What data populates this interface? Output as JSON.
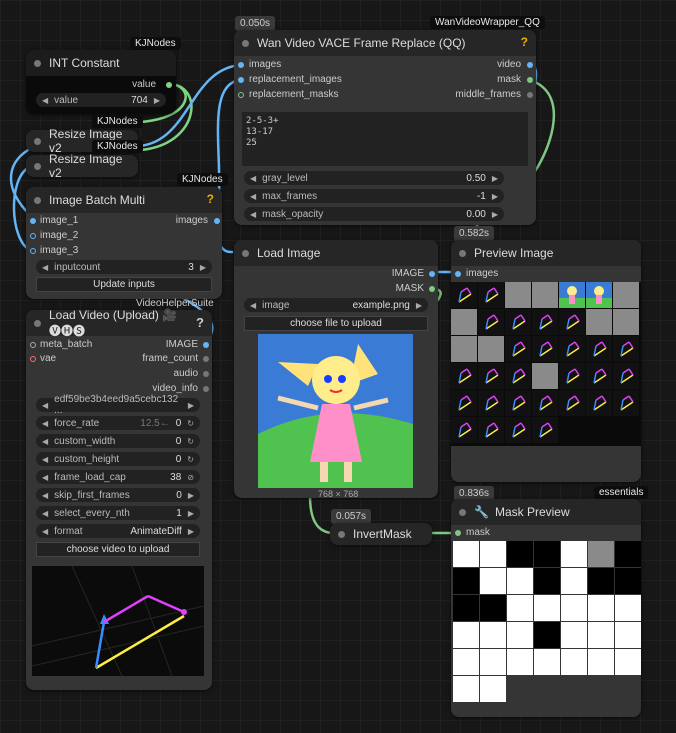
{
  "nodes": {
    "int_constant": {
      "title": "INT Constant",
      "badge": "KJNodes",
      "output": "value",
      "widget_label": "value",
      "widget_value": "704"
    },
    "resize1": {
      "title": "Resize Image v2",
      "badge": "KJNodes"
    },
    "resize2": {
      "title": "Resize Image v2",
      "badge": "KJNodes"
    },
    "batch": {
      "title": "Image Batch Multi",
      "badge": "KJNodes",
      "help": "?",
      "inputs": [
        "image_1",
        "image_2",
        "image_3"
      ],
      "output": "images",
      "widget_label": "inputcount",
      "widget_value": "3",
      "button": "Update inputs"
    },
    "load_video": {
      "title": "Load Video (Upload) 🎥🅥🅗🅢",
      "badge": "VideoHelperSuite",
      "help": "?",
      "inputs": [
        "meta_batch",
        "vae"
      ],
      "outputs": [
        "IMAGE",
        "frame_count",
        "audio",
        "video_info"
      ],
      "file": "edf59be3b4eed9a5cebc132 ...",
      "widgets": [
        {
          "label": "force_rate",
          "value": "0",
          "hint": "12.5←"
        },
        {
          "label": "custom_width",
          "value": "0"
        },
        {
          "label": "custom_height",
          "value": "0"
        },
        {
          "label": "frame_load_cap",
          "value": "38"
        },
        {
          "label": "skip_first_frames",
          "value": "0"
        },
        {
          "label": "select_every_nth",
          "value": "1"
        },
        {
          "label": "format",
          "value": "AnimateDiff"
        }
      ],
      "button": "choose video to upload"
    },
    "vace": {
      "title": "Wan Video VACE Frame Replace (QQ)",
      "badge": "WanVideoWrapper_QQ",
      "timing": "0.050s",
      "help": "?",
      "inputs": [
        "images",
        "replacement_images",
        "replacement_masks"
      ],
      "outputs": [
        "video",
        "mask",
        "middle_frames"
      ],
      "text": "2-5-3+\n13-17\n25",
      "widgets": [
        {
          "label": "gray_level",
          "value": "0.50"
        },
        {
          "label": "max_frames",
          "value": "-1"
        },
        {
          "label": "mask_opacity",
          "value": "0.00"
        }
      ]
    },
    "load_image": {
      "title": "Load Image",
      "outputs": [
        "IMAGE",
        "MASK"
      ],
      "widget_label": "image",
      "widget_value": "example.png",
      "button": "choose file to upload",
      "dims": "768 × 768"
    },
    "preview": {
      "title": "Preview Image",
      "timing": "0.582s",
      "input": "images"
    },
    "invert": {
      "title": "InvertMask",
      "timing": "0.057s"
    },
    "mask_preview": {
      "title": "Mask Preview",
      "timing": "0.836s",
      "badge": "essentials",
      "input": "mask"
    }
  },
  "colors": {
    "image": "#64b5f6",
    "mask": "#81c784",
    "int": "#7fd483",
    "vae": "#ff6e6e"
  }
}
